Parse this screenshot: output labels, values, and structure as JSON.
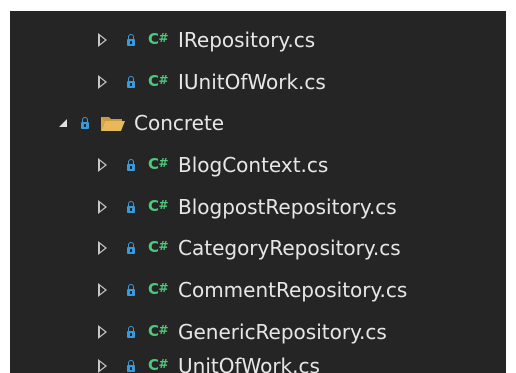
{
  "colors": {
    "panel_background": "#252526",
    "text": "#e6e6e6",
    "arrow": "#c8c8c8",
    "lock_icon": "#3a9ad9",
    "csharp_badge": "#4ec97a",
    "folder": "#e8b95a"
  },
  "badges": {
    "csharp": "C#"
  },
  "tree": {
    "items": [
      {
        "label": "IRepository.cs",
        "icon": "csharp-file-icon",
        "state": "collapsed"
      },
      {
        "label": "IUnitOfWork.cs",
        "icon": "csharp-file-icon",
        "state": "collapsed"
      },
      {
        "label": "Concrete",
        "icon": "folder-icon",
        "state": "expanded"
      },
      {
        "label": "BlogContext.cs",
        "icon": "csharp-file-icon",
        "state": "collapsed"
      },
      {
        "label": "BlogpostRepository.cs",
        "icon": "csharp-file-icon",
        "state": "collapsed"
      },
      {
        "label": "CategoryRepository.cs",
        "icon": "csharp-file-icon",
        "state": "collapsed"
      },
      {
        "label": "CommentRepository.cs",
        "icon": "csharp-file-icon",
        "state": "collapsed"
      },
      {
        "label": "GenericRepository.cs",
        "icon": "csharp-file-icon",
        "state": "collapsed"
      },
      {
        "label": "UnitOfWork.cs",
        "icon": "csharp-file-icon",
        "state": "collapsed"
      }
    ]
  }
}
